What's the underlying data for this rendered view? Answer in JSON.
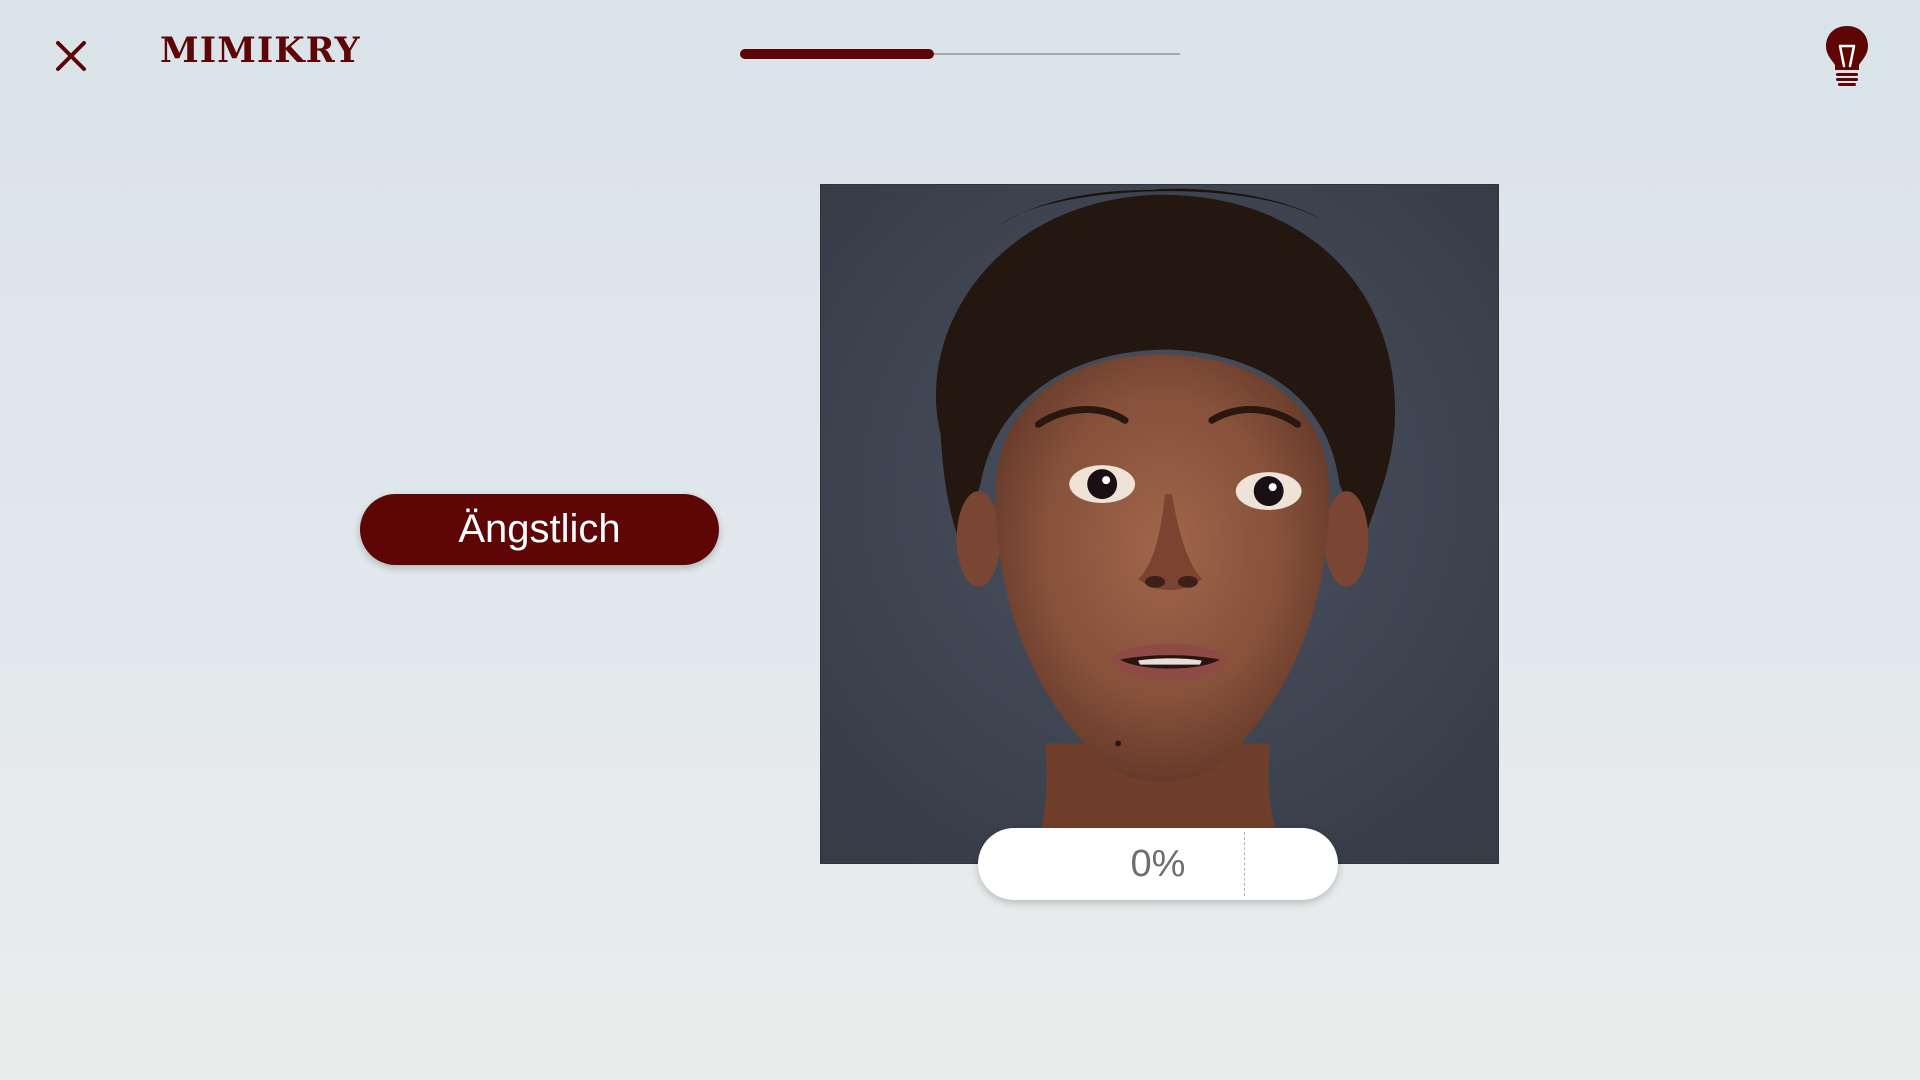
{
  "header": {
    "title": "MIMIKRY",
    "close_icon": "close-icon",
    "hint_icon": "lightbulb-icon",
    "progress": 0.44
  },
  "answer": {
    "label": "Ängstlich"
  },
  "photo": {
    "subject": "face-photo"
  },
  "intensity": {
    "value_label": "0%",
    "value": 0
  },
  "colors": {
    "accent": "#5e0606",
    "background": "#dfe6ea",
    "photo_background": "#3f4551",
    "pill_text": "#ffffff"
  }
}
